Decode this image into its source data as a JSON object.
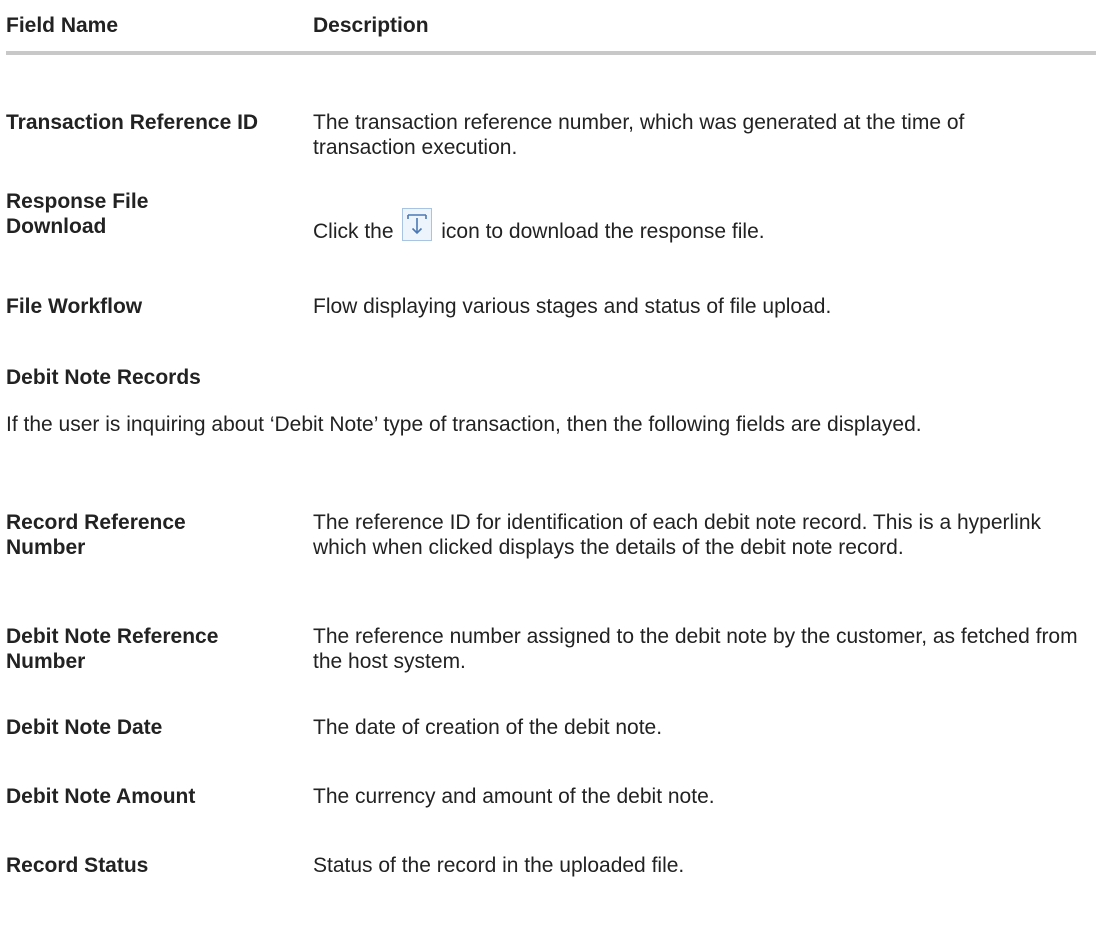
{
  "header": {
    "col_field": "Field Name",
    "col_desc": "Description"
  },
  "rows_top": [
    {
      "field": "Transaction Reference ID",
      "desc": "The transaction reference number, which was generated at the time of transaction execution."
    },
    {
      "field": "Response File Download",
      "desc_before": "Click the",
      "desc_after": "icon to download the response file.",
      "icon": "download-icon"
    },
    {
      "field": "File Workflow",
      "desc": "Flow displaying various stages and status of file upload."
    }
  ],
  "section": {
    "title": "Debit Note Records",
    "intro": "If the user is inquiring about ‘Debit Note’ type of transaction, then the following fields are displayed."
  },
  "rows_bottom": [
    {
      "field": "Record Reference Number",
      "desc": "The reference ID for identification of each debit note record. This is a hyperlink which when clicked displays the details of the debit note record."
    },
    {
      "field": "Debit Note Reference Number",
      "desc": "The reference number assigned to the debit note by the customer, as fetched from the host system."
    },
    {
      "field": "Debit Note Date",
      "desc": "The date of creation of the debit note."
    },
    {
      "field": "Debit Note Amount",
      "desc": "The currency and amount of the debit note."
    },
    {
      "field": "Record Status",
      "desc": "Status of the record in the uploaded file."
    }
  ]
}
